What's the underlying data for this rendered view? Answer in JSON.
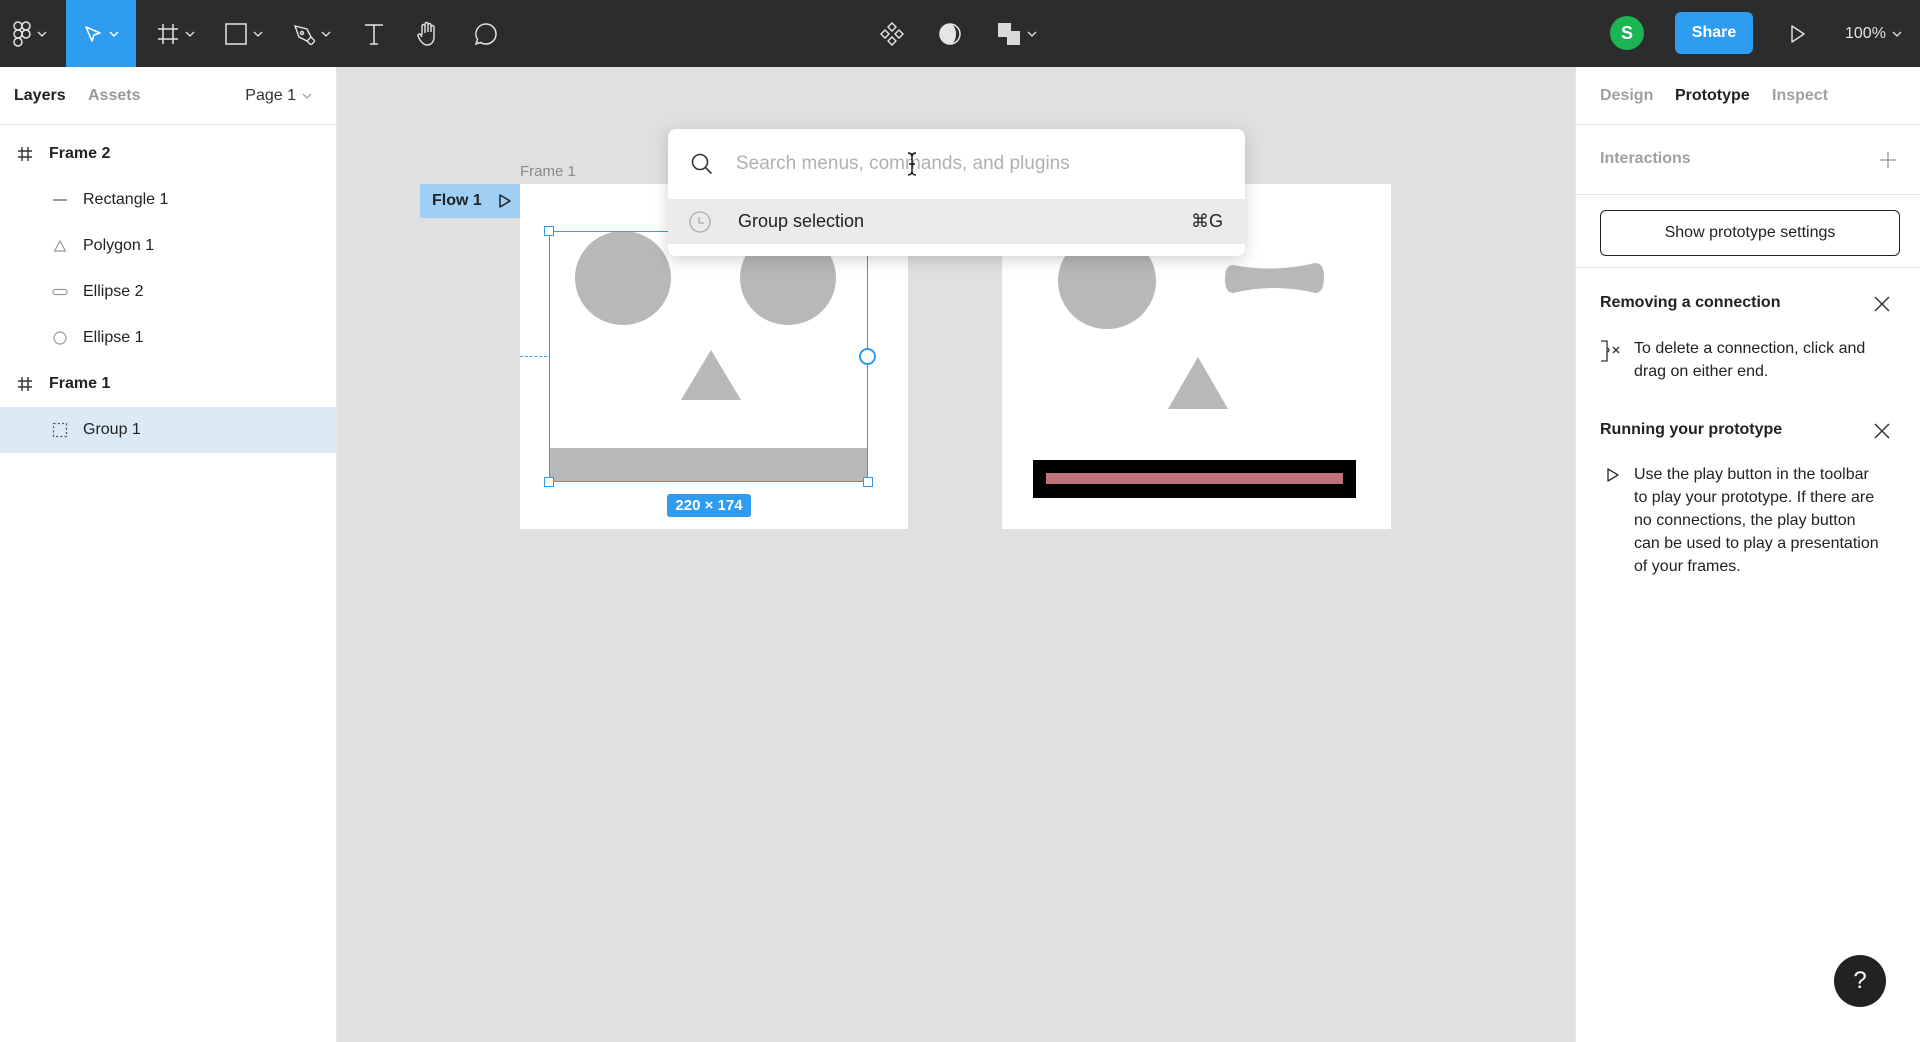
{
  "toolbar": {
    "tools": [
      {
        "name": "main-menu",
        "icon": "figma-logo-icon",
        "has_dropdown": true
      },
      {
        "name": "move-tool",
        "icon": "cursor-arrow-icon",
        "has_dropdown": true,
        "active": true
      },
      {
        "name": "frame-tool",
        "icon": "frame-hash-icon",
        "has_dropdown": true
      },
      {
        "name": "shape-tool",
        "icon": "rectangle-icon",
        "has_dropdown": true
      },
      {
        "name": "pen-tool",
        "icon": "pen-icon",
        "has_dropdown": true
      },
      {
        "name": "text-tool",
        "icon": "text-icon",
        "has_dropdown": false
      },
      {
        "name": "hand-tool",
        "icon": "hand-icon",
        "has_dropdown": false
      },
      {
        "name": "comment-tool",
        "icon": "comment-icon",
        "has_dropdown": false
      }
    ],
    "center_tools": [
      {
        "name": "components",
        "icon": "component-icon"
      },
      {
        "name": "mask",
        "icon": "mask-icon"
      },
      {
        "name": "boolean-ops",
        "icon": "boolean-icon",
        "has_dropdown": true
      }
    ],
    "avatar_initial": "S",
    "share_label": "Share",
    "zoom_level": "100%"
  },
  "left_panel": {
    "tabs": [
      {
        "label": "Layers",
        "active": true
      },
      {
        "label": "Assets",
        "active": false
      }
    ],
    "page_select": "Page 1",
    "layers": [
      {
        "name": "Frame 2",
        "type": "frame",
        "icon": "frame-icon"
      },
      {
        "name": "Rectangle 1",
        "type": "child",
        "icon": "line-icon"
      },
      {
        "name": "Polygon 1",
        "type": "child",
        "icon": "triangle-icon"
      },
      {
        "name": "Ellipse 2",
        "type": "child",
        "icon": "pill-icon"
      },
      {
        "name": "Ellipse 1",
        "type": "child",
        "icon": "circle-icon"
      },
      {
        "name": "Frame 1",
        "type": "frame",
        "icon": "frame-icon"
      },
      {
        "name": "Group 1",
        "type": "child",
        "icon": "group-icon",
        "selected": true
      }
    ]
  },
  "canvas": {
    "frame1_label": "Frame 1",
    "flow_label": "Flow 1",
    "selection_size": "220 × 174",
    "colors": {
      "shape_gray": "#b8b8b8",
      "selection_blue": "#2d9cf1",
      "bar_pink": "#c0717a",
      "bar_black": "#000000"
    }
  },
  "command_palette": {
    "placeholder": "Search menus, commands, and plugins",
    "value": "",
    "items": [
      {
        "label": "Group selection",
        "shortcut": "⌘G",
        "icon": "clock-icon"
      }
    ]
  },
  "right_panel": {
    "tabs": [
      {
        "label": "Design",
        "active": false
      },
      {
        "label": "Prototype",
        "active": true
      },
      {
        "label": "Inspect",
        "active": false
      }
    ],
    "interactions_label": "Interactions",
    "show_settings_label": "Show prototype settings",
    "tips": [
      {
        "title": "Removing a connection",
        "body": "To delete a connection, click and drag on either end."
      },
      {
        "title": "Running your prototype",
        "body": "Use the play button in the toolbar to play your prototype. If there are no connections, the play button can be used to play a presentation of your frames."
      }
    ]
  },
  "help_label": "?"
}
